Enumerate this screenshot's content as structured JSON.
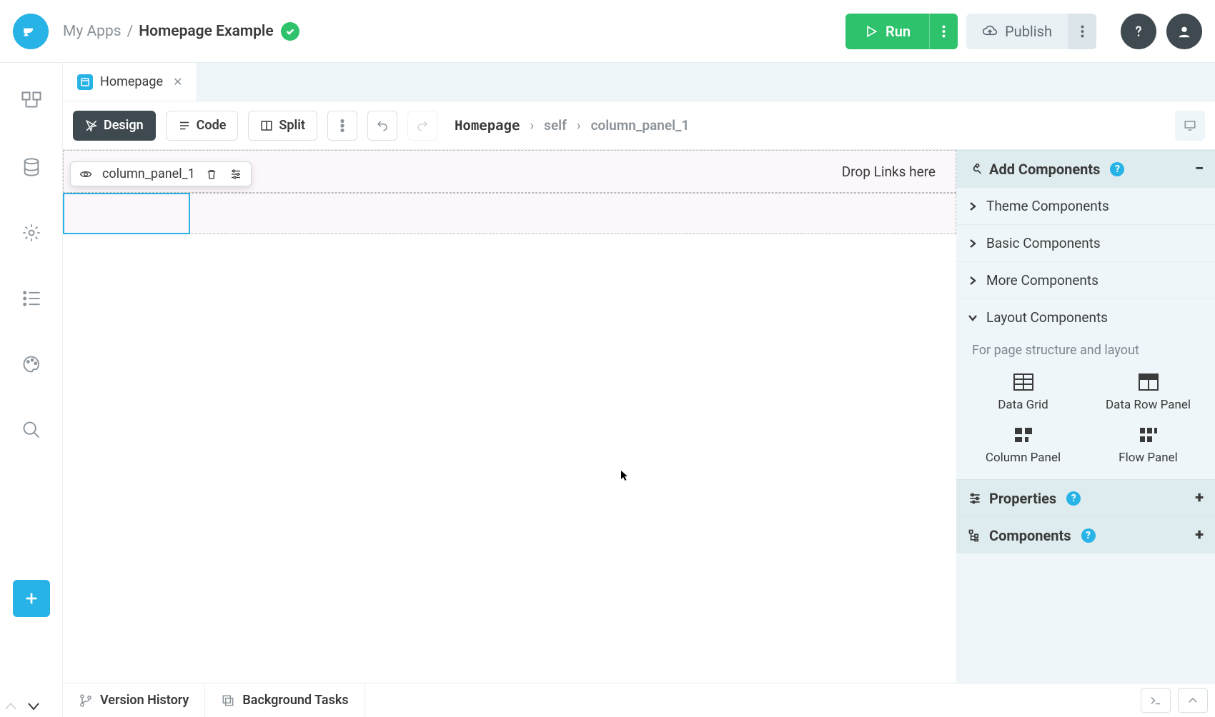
{
  "topbar": {
    "breadcrumb_root": "My Apps",
    "breadcrumb_current": "Homepage Example",
    "run_label": "Run",
    "publish_label": "Publish"
  },
  "tabs": {
    "t0_label": "Homepage"
  },
  "toolbar2": {
    "design": "Design",
    "code": "Code",
    "split": "Split",
    "path0": "Homepage",
    "path1": "self",
    "path2": "column_panel_1"
  },
  "canvas": {
    "dropzone_text": "Drop Links here",
    "selected_name": "column_panel_1"
  },
  "rightpanel": {
    "add_components": "Add Components",
    "theme": "Theme Components",
    "basic": "Basic Components",
    "more": "More Components",
    "layout": "Layout Components",
    "layout_desc": "For page structure and layout",
    "comp_data_grid": "Data Grid",
    "comp_data_row": "Data Row Panel",
    "comp_column": "Column Panel",
    "comp_flow": "Flow Panel",
    "properties": "Properties",
    "components": "Components"
  },
  "bottom": {
    "version_history": "Version History",
    "background_tasks": "Background Tasks"
  }
}
